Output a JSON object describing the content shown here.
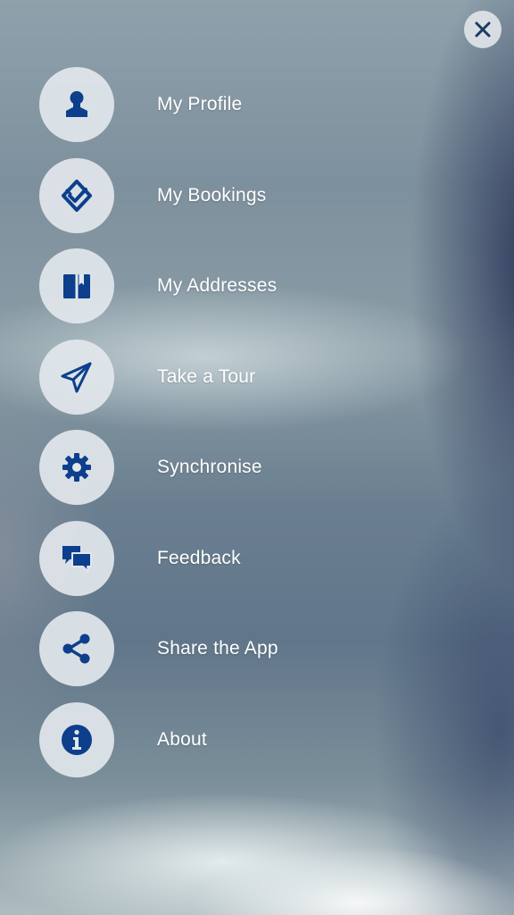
{
  "colors": {
    "accent": "#0d3f8c",
    "label": "#ffffff",
    "icon_bg": "#e2e7ec"
  },
  "close_button": {
    "icon": "close-icon"
  },
  "menu": {
    "items": [
      {
        "label": "My Profile",
        "icon": "user-icon"
      },
      {
        "label": "My Bookings",
        "icon": "double-check-icon"
      },
      {
        "label": "My Addresses",
        "icon": "address-book-icon"
      },
      {
        "label": "Take a Tour",
        "icon": "paper-plane-icon"
      },
      {
        "label": "Synchronise",
        "icon": "gear-icon"
      },
      {
        "label": "Feedback",
        "icon": "chat-bubbles-icon"
      },
      {
        "label": "Share the App",
        "icon": "share-icon"
      },
      {
        "label": "About",
        "icon": "info-icon"
      }
    ]
  }
}
